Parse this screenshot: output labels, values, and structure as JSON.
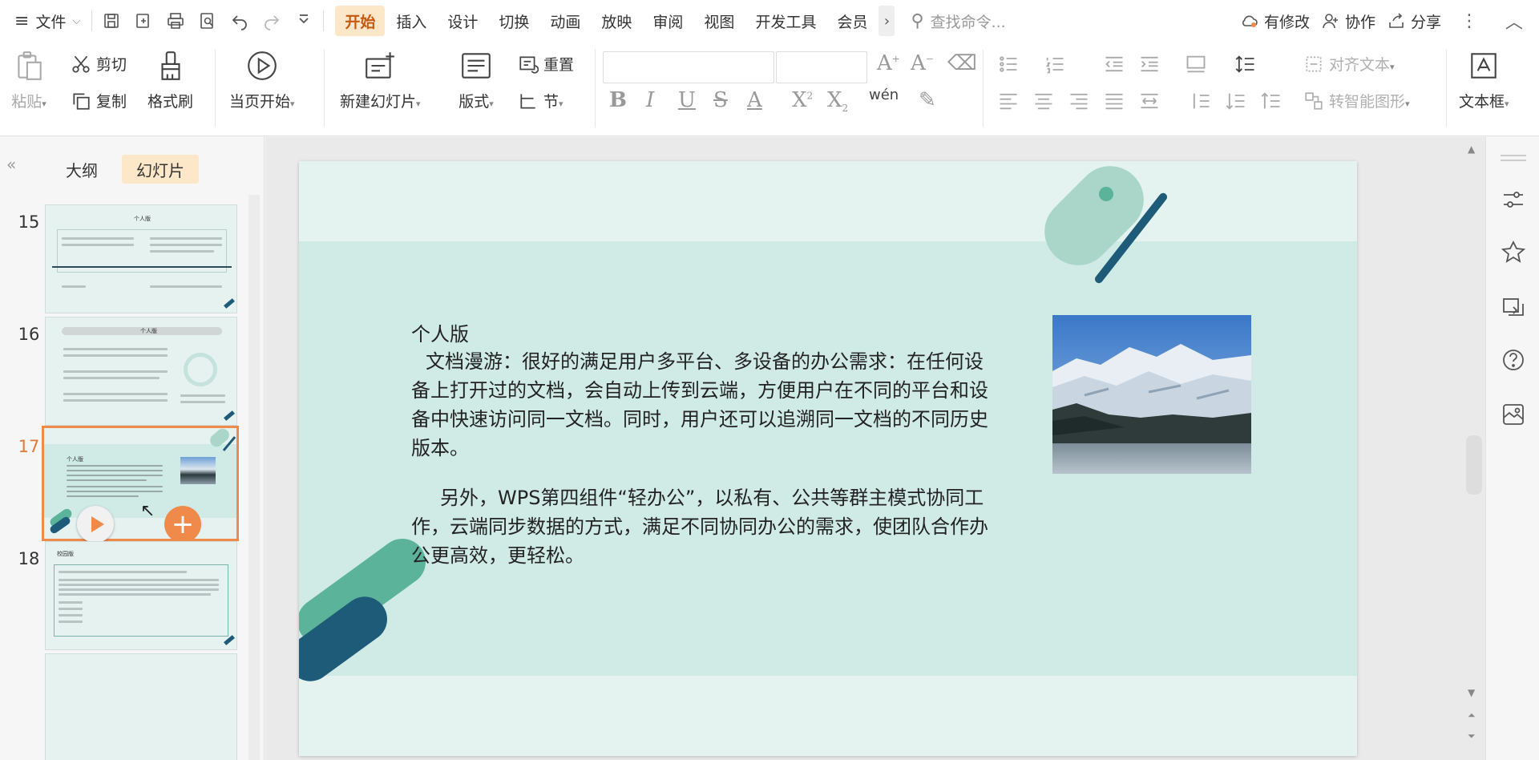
{
  "menubar": {
    "file_label": "文件",
    "tabs": [
      "开始",
      "插入",
      "设计",
      "切换",
      "动画",
      "放映",
      "审阅",
      "视图",
      "开发工具",
      "会员"
    ],
    "active_tab": "开始",
    "search_placeholder": "查找命令...",
    "modified_label": "有修改",
    "collab_label": "协作",
    "share_label": "分享"
  },
  "ribbon": {
    "paste": "粘贴",
    "cut": "剪切",
    "copy": "复制",
    "format_painter": "格式刷",
    "play_from_current": "当页开始",
    "new_slide": "新建幻灯片",
    "layout": "版式",
    "reset": "重置",
    "section": "节",
    "align_text": "对齐文本",
    "smart_art": "转智能图形",
    "textbox": "文本框",
    "pinyin": "wén"
  },
  "left_panel": {
    "outline_tab": "大纲",
    "slides_tab": "幻灯片",
    "slides": [
      {
        "num": "15",
        "title": "个人版"
      },
      {
        "num": "16",
        "title": "个人版"
      },
      {
        "num": "17",
        "title": "个人版"
      },
      {
        "num": "18",
        "title": "校园版"
      }
    ],
    "current_slide": "17"
  },
  "slide": {
    "title": "个人版",
    "para1": "文档漫游：很好的满足用户多平台、多设备的办公需求：在任何设备上打开过的文档，会自动上传到云端，方便用户在不同的平台和设备中快速访问同一文档。同时，用户还可以追溯同一文档的不同历史版本。",
    "para2": "另外，WPS第四组件“轻办公”，以私有、公共等群主模式协同工作，云端同步数据的方式，满足不同协同办公的需求，使团队合作办公更高效，更轻松。"
  },
  "colors": {
    "accent": "#f08a4b",
    "active_tab_bg": "#fde7c9",
    "slide_band": "#d0ebe6",
    "deco_light": "#a9d6c9",
    "deco_green": "#5bb39a",
    "deco_dark": "#1e5b78"
  }
}
